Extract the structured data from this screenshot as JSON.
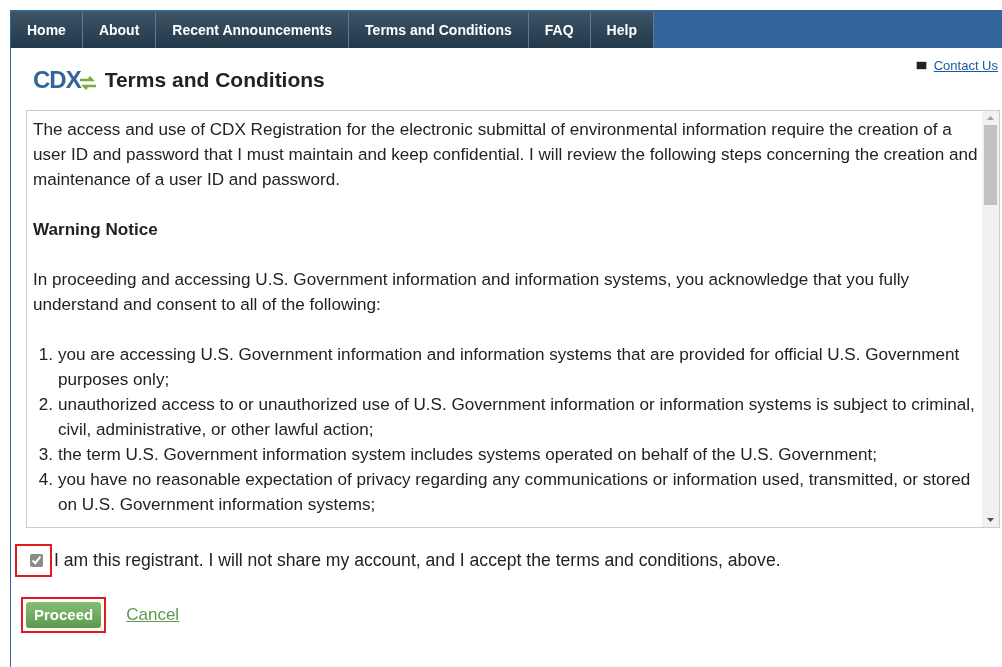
{
  "nav": [
    {
      "label": "Home",
      "selected": false
    },
    {
      "label": "About",
      "selected": false
    },
    {
      "label": "Recent Announcements",
      "selected": false
    },
    {
      "label": "Terms and Conditions",
      "selected": false
    },
    {
      "label": "FAQ",
      "selected": false
    },
    {
      "label": "Help",
      "selected": false
    }
  ],
  "logo": "CDX",
  "title": "Terms and Conditions",
  "contact": "Contact Us",
  "terms": {
    "intro": "The access and use of CDX Registration for the electronic submittal of environmental information require the creation of a user ID and password that I must maintain and keep confidential. I will review the following steps concerning the creation and maintenance of a user ID and password.",
    "heading": "Warning Notice",
    "lead": "In proceeding and accessing U.S. Government information and information systems, you acknowledge that you fully understand and consent to all of the following:",
    "items": [
      {
        "number": "1.",
        "text": "you are accessing U.S. Government information and information systems that are provided for official U.S. Government purposes only;"
      },
      {
        "number": "2.",
        "text": "unauthorized access to or unauthorized use of U.S. Government information or information systems is subject to criminal, civil, administrative, or other lawful action;"
      },
      {
        "number": "3.",
        "text": "the term U.S. Government information system includes systems operated on behalf of the U.S. Government;"
      },
      {
        "number": "4.",
        "text": "you have no reasonable expectation of privacy regarding any communications or information used, transmitted, or stored on U.S. Government information systems;"
      }
    ]
  },
  "accept": {
    "label": "I am this registrant. I will not share my account, and I accept the terms and conditions, above.",
    "checked": true,
    "highlighted": true
  },
  "proceed": {
    "label": "Proceed",
    "highlighted": true
  },
  "cancel": "Cancel"
}
